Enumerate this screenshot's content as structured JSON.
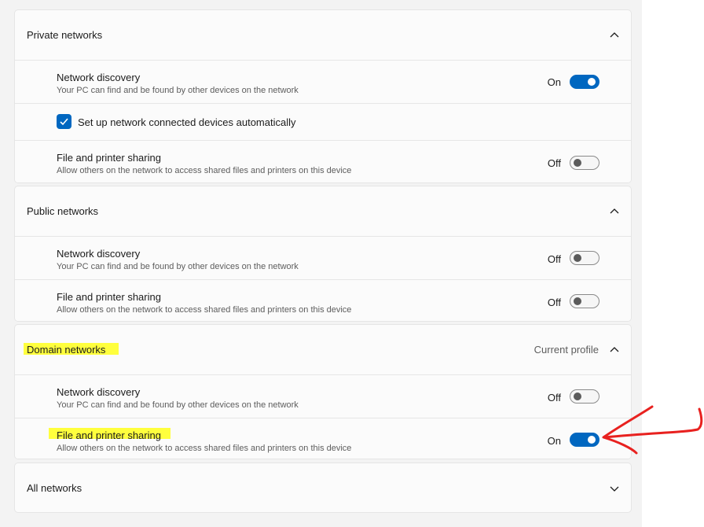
{
  "private": {
    "title": "Private networks",
    "discovery": {
      "title": "Network discovery",
      "desc": "Your PC can find and be found by other devices on the network",
      "state": "On",
      "on": true
    },
    "auto_setup": {
      "label": "Set up network connected devices automatically",
      "checked": true
    },
    "sharing": {
      "title": "File and printer sharing",
      "desc": "Allow others on the network to access shared files and printers on this device",
      "state": "Off",
      "on": false
    }
  },
  "public": {
    "title": "Public networks",
    "discovery": {
      "title": "Network discovery",
      "desc": "Your PC can find and be found by other devices on the network",
      "state": "Off",
      "on": false
    },
    "sharing": {
      "title": "File and printer sharing",
      "desc": "Allow others on the network to access shared files and printers on this device",
      "state": "Off",
      "on": false
    }
  },
  "domain": {
    "title": "Domain networks",
    "profile": "Current profile",
    "discovery": {
      "title": "Network discovery",
      "desc": "Your PC can find and be found by other devices on the network",
      "state": "Off",
      "on": false
    },
    "sharing": {
      "title": "File and printer sharing",
      "desc": "Allow others on the network to access shared files and printers on this device",
      "state": "On",
      "on": true
    }
  },
  "all": {
    "title": "All networks"
  },
  "colors": {
    "accent": "#0067c0",
    "highlight": "#ffff3d",
    "annotation": "#e8211f"
  },
  "icons": {
    "expanded": "chevron-up-icon",
    "collapsed": "chevron-down-icon",
    "check": "checkmark-icon",
    "annotation": "red-arrow-icon"
  }
}
